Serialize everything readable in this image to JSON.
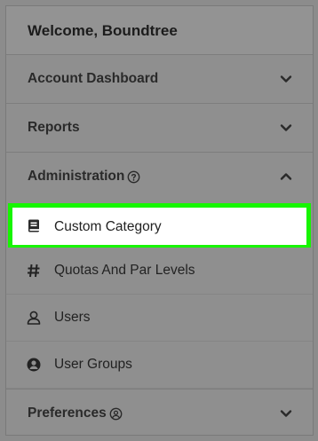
{
  "menu": {
    "welcome": "Welcome, Boundtree",
    "sections": [
      {
        "label": "Account Dashboard",
        "expanded": false
      },
      {
        "label": "Reports",
        "expanded": false
      },
      {
        "label": "Administration",
        "expanded": true
      },
      {
        "label": "Preferences",
        "expanded": false
      }
    ],
    "administration_items": [
      {
        "label": "Custom Category",
        "icon": "book-icon",
        "selected": true
      },
      {
        "label": "Quotas And Par Levels",
        "icon": "hash-icon",
        "selected": false
      },
      {
        "label": "Users",
        "icon": "user-icon",
        "selected": false
      },
      {
        "label": "User Groups",
        "icon": "user-circle-icon",
        "selected": false
      }
    ]
  },
  "colors": {
    "highlight_border": "#16f500",
    "overlay_gray": "#8f8f8f"
  }
}
